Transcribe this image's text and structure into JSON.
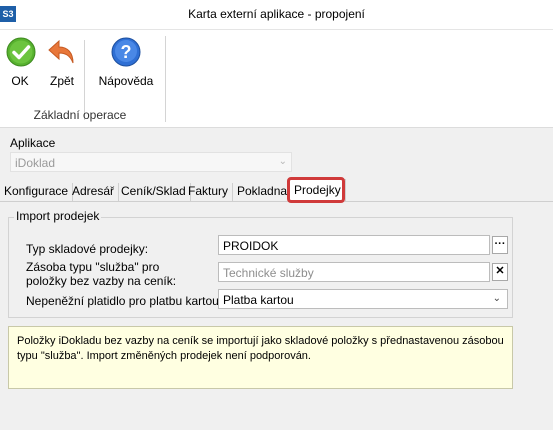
{
  "window": {
    "title": "Karta externí aplikace - propojení",
    "app_icon_text": "S3"
  },
  "ribbon": {
    "ok_label": "OK",
    "back_label": "Zpět",
    "help_label": "Nápověda",
    "group_label": "Základní operace"
  },
  "application": {
    "label": "Aplikace",
    "value": "iDoklad"
  },
  "tabs": [
    {
      "label": "Konfigurace"
    },
    {
      "label": "Adresář"
    },
    {
      "label": "Ceník/Sklad"
    },
    {
      "label": "Faktury"
    },
    {
      "label": "Pokladna"
    },
    {
      "label": "Prodejky",
      "active": true
    }
  ],
  "import_section": {
    "legend": "Import prodejek",
    "fields": [
      {
        "label": "Typ skladové prodejky:",
        "value": "PROIDOK"
      },
      {
        "label_line1": "Zásoba typu \"služba\" pro",
        "label_line2": "položky bez vazby na ceník:",
        "placeholder": "Technické služby"
      },
      {
        "label": "Nepeněžní platidlo pro platbu kartou:",
        "value": "Platba kartou"
      }
    ]
  },
  "note": {
    "line1": "Položky iDokladu bez vazby na ceník se importují jako skladové položky s přednastavenou zásobou",
    "line2": "typu \"služba\". Import změněných prodejek není podporován."
  },
  "colors": {
    "ok_green": "#57b12f",
    "back_orange": "#e8773a",
    "help_blue": "#2f6fd4",
    "highlight_red": "#d03a3a",
    "note_bg": "#ffffe1"
  }
}
